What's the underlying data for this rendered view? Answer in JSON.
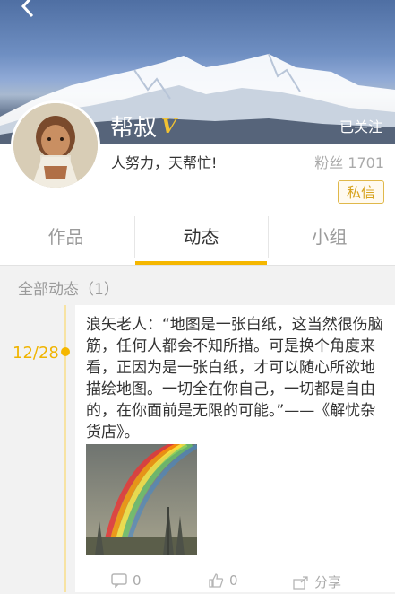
{
  "header": {
    "back_icon": "chevron-left-icon"
  },
  "profile": {
    "name": "帮叔",
    "badge": "V",
    "follow_status": "已关注",
    "motto": "人努力，天帮忙!",
    "fans": "粉丝 1701",
    "message_button": "私信"
  },
  "tabs": [
    {
      "label": "作品",
      "active": false
    },
    {
      "label": "动态",
      "active": true
    },
    {
      "label": "小组",
      "active": false
    }
  ],
  "feed": {
    "section_title": "全部动态（1）",
    "posts": [
      {
        "date": "12/28",
        "text": "浪矢老人：“地图是一张白纸，这当然很伤脑筋，任何人都会不知所措。可是换个角度来看，正因为是一张白纸，才可以随心所欲地描绘地图。一切全在你自己，一切都是自由的，在你面前是无限的可能。”——《解忧杂货店》。",
        "comments": "0",
        "likes": "0",
        "share": "分享"
      }
    ]
  },
  "colors": {
    "accent": "#f5b700",
    "badge_gold": "#f1c232",
    "date": "#f0b400"
  }
}
